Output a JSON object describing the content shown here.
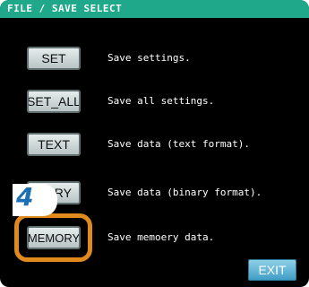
{
  "title": "FILE / SAVE SELECT",
  "options": [
    {
      "button": "SET",
      "description": "Save settings."
    },
    {
      "button": "SET_ALL",
      "description": "Save all settings."
    },
    {
      "button": "TEXT",
      "description": "Save data (text format)."
    },
    {
      "button": "NARY",
      "description": "Save data (binary format)."
    },
    {
      "button": "MEMORY",
      "description": "Save memoery data."
    }
  ],
  "step_marker": "4",
  "exit_label": "EXIT",
  "colors": {
    "title_bar": "#1fa88a",
    "highlight": "#e08a1e",
    "step_number": "#1c6fb3",
    "exit_button": "#3f9fc6"
  }
}
